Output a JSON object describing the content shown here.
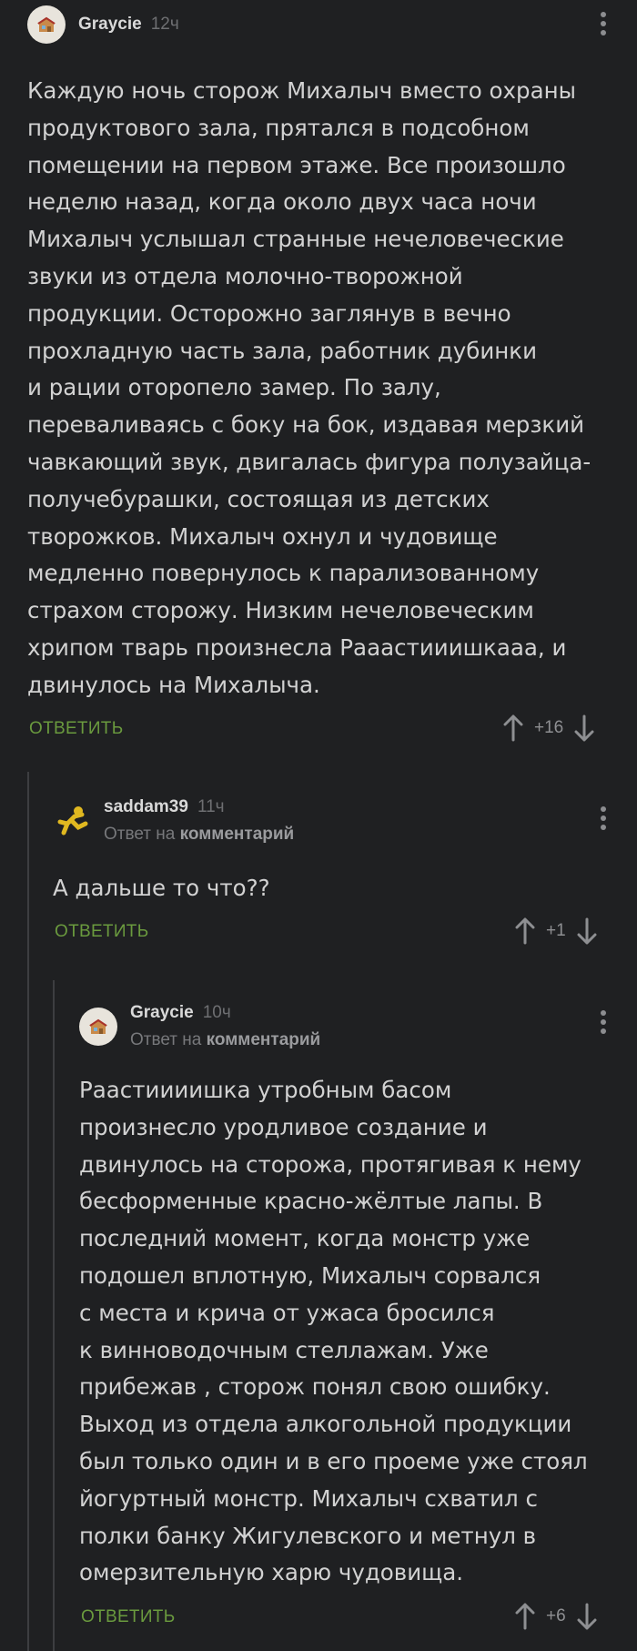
{
  "comments": [
    {
      "author": "Graycie",
      "time": "12ч",
      "text": "Каждую ночь сторож Михалыч вместо охраны\nпродуктового зала, прятался в подсобном\nпомещении на первом этаже. Все произошло\nнеделю назад, когда около двух часа ночи\nМихалыч услышал странные нечеловеческие\nзвуки из отдела молочно-творожной\nпродукции.  Осторожно заглянув в вечно\nпрохладную часть зала, работник дубинки\nи рации оторопело замер. По залу,\nпереваливаясь с боку на бок, издавая мерзкий\nчавкающий звук, двигалась фигура полузайца-\nполучебурашки, состоящая из детских\nтворожков. Михалыч охнул и чудовище\nмедленно повернулось к парализованному\nстрахом сторожу. Низким нечеловеческим\nхрипом тварь произнесла  Рааастииишкааа, и\nдвинулось на Михалыча.",
      "reply_label": "ОТВЕТИТЬ",
      "score": "+16",
      "avatar": "house-icon"
    },
    {
      "author": "saddam39",
      "time": "11ч",
      "reply_prefix": "Ответ на",
      "reply_target": "комментарий",
      "text": "А дальше то что??",
      "reply_label": "ОТВЕТИТЬ",
      "score": "+1",
      "avatar": "runner-icon"
    },
    {
      "author": "Graycie",
      "time": "10ч",
      "reply_prefix": "Ответ на",
      "reply_target": "комментарий",
      "text": "Раастиииишка утробным басом\nпроизнесло уродливое создание и\nдвинулось на сторожа, протягивая к нему\nбесформенные красно-жёлтые лапы. В\nпоследний момент, когда монстр уже\nподошел вплотную, Михалыч сорвался\nс места и крича от ужаса бросился\nк винноводочным стеллажам. Уже\nприбежав , сторож понял свою ошибку.\nВыход из отдела алкогольной продукции\nбыл только один и в его проеме уже стоял\nйогуртный монстр. Михалыч схватил с\nполки банку Жигулевского и метнул в\nомерзительную харю чудовища.",
      "reply_label": "ОТВЕТИТЬ",
      "score": "+6",
      "avatar": "house-icon"
    }
  ],
  "colors": {
    "background": "#1f2022",
    "reply_green": "#6a9a3e",
    "text": "#d2d2d2",
    "muted": "#6e6f72"
  }
}
